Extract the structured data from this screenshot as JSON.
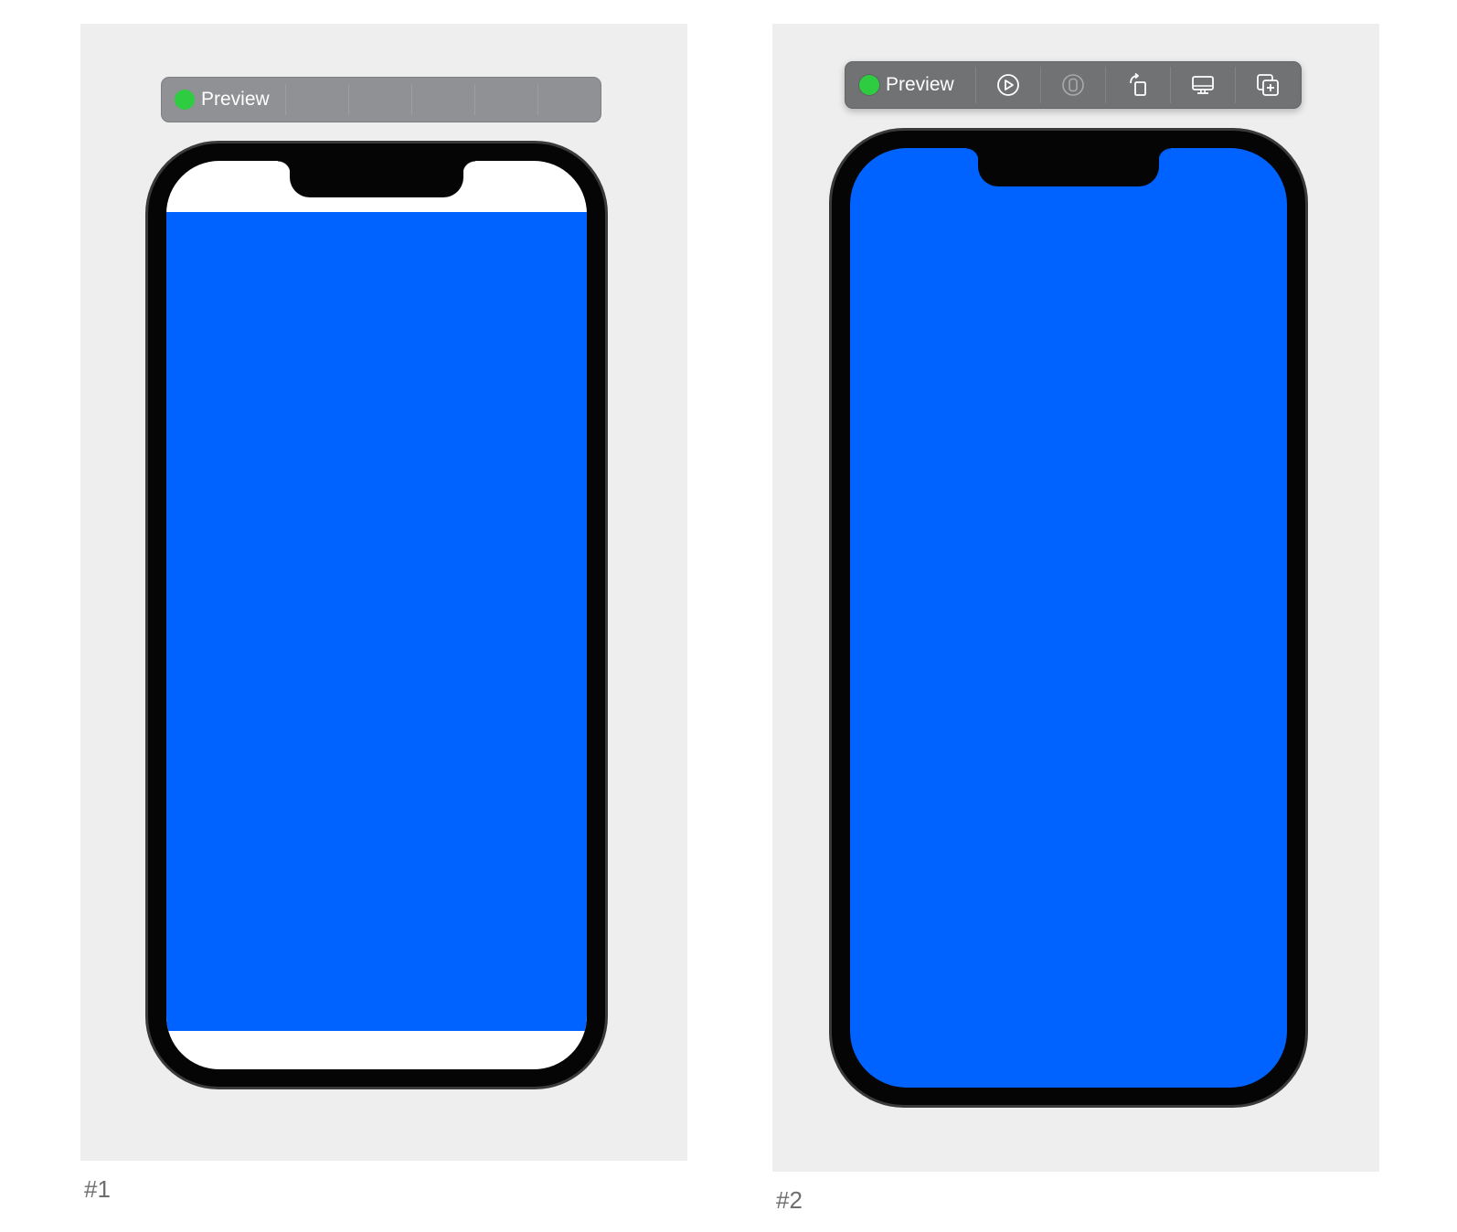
{
  "previews": [
    {
      "caption": "#1",
      "toolbar": {
        "label": "Preview",
        "status_icon": "green-status-dot",
        "active": false
      },
      "screen": {
        "background_color": "#ffffff",
        "content_color": "#0063ff",
        "content_ignores_safe_area": false
      }
    },
    {
      "caption": "#2",
      "toolbar": {
        "label": "Preview",
        "status_icon": "green-status-dot",
        "active": true,
        "buttons": [
          {
            "name": "live-preview",
            "icon": "play-circle-icon"
          },
          {
            "name": "select-mode",
            "icon": "selectable-icon",
            "disabled": true
          },
          {
            "name": "rotate-device",
            "icon": "rotate-device-icon"
          },
          {
            "name": "device-settings",
            "icon": "device-settings-icon"
          },
          {
            "name": "duplicate-preview",
            "icon": "duplicate-plus-icon"
          }
        ]
      },
      "screen": {
        "background_color": "#0063ff",
        "content_color": "#0063ff",
        "content_ignores_safe_area": true
      }
    }
  ],
  "colors": {
    "canvas_background": "#eeeeee",
    "status_green": "#2ecc40",
    "device_frame": "#050505"
  }
}
